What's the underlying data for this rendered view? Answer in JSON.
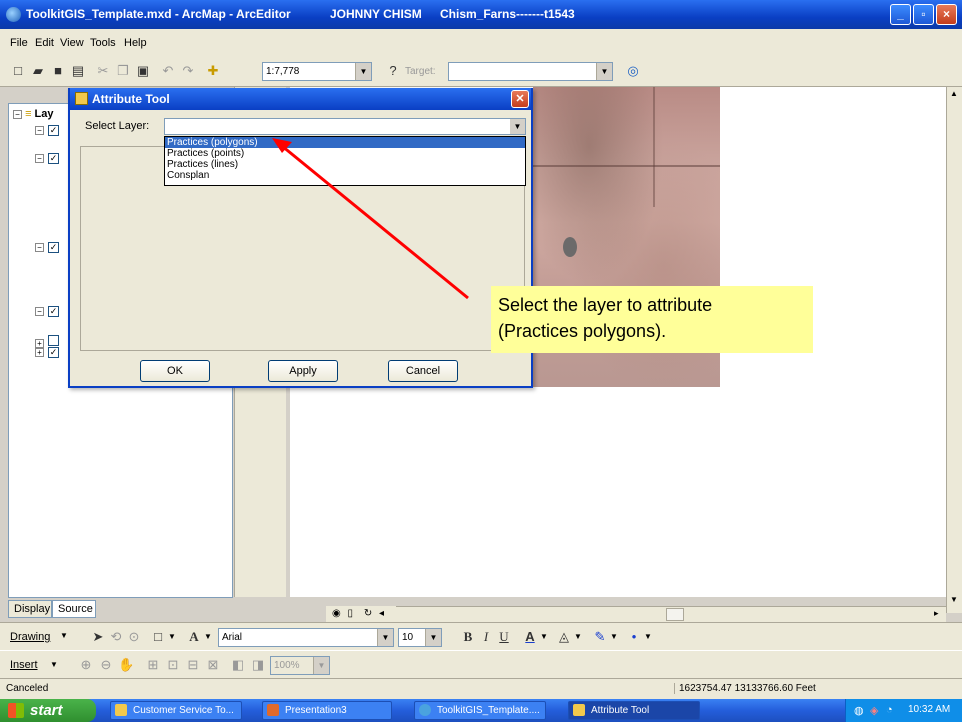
{
  "window": {
    "title_file": "ToolkitGIS_Template.mxd - ArcMap - ArcEditor",
    "title_user": "JOHNNY CHISM",
    "title_project": "Chism_Farns-------t1543"
  },
  "menu": [
    "File",
    "Edit",
    "View",
    "Tools",
    "Help"
  ],
  "toolbar": {
    "scale": "1:7,778",
    "target_label": "Target:",
    "target_value": ""
  },
  "toc": {
    "layers_label": "Lay",
    "tabs": [
      "Display",
      "Source"
    ]
  },
  "dialog": {
    "title": "Attribute Tool",
    "select_label": "Select Layer:",
    "layer_value": "",
    "options": [
      "Practices (polygons)",
      "Practices (points)",
      "Practices (lines)",
      "Consplan"
    ],
    "selected_index": 0,
    "ok": "OK",
    "apply": "Apply",
    "cancel": "Cancel"
  },
  "callout": {
    "line1": "Select the layer to attribute",
    "line2": "(Practices polygons)."
  },
  "drawing": {
    "drawing_label": "Drawing",
    "font": "Arial",
    "size": "10",
    "insert_label": "Insert",
    "zoom": "100%"
  },
  "status": {
    "message": "Canceled",
    "coords": "1623754.47  13133766.60 Feet"
  },
  "taskbar": {
    "start": "start",
    "tasks": [
      "Customer Service To...",
      "Presentation3",
      "ToolkitGIS_Template....",
      "Attribute Tool"
    ],
    "clock": "10:32 AM"
  },
  "colors": {
    "title_blue": "#0a3fc4",
    "callout_yellow": "#ffff99",
    "arrow_red": "#ff0000",
    "selection_blue": "#316ac5"
  }
}
